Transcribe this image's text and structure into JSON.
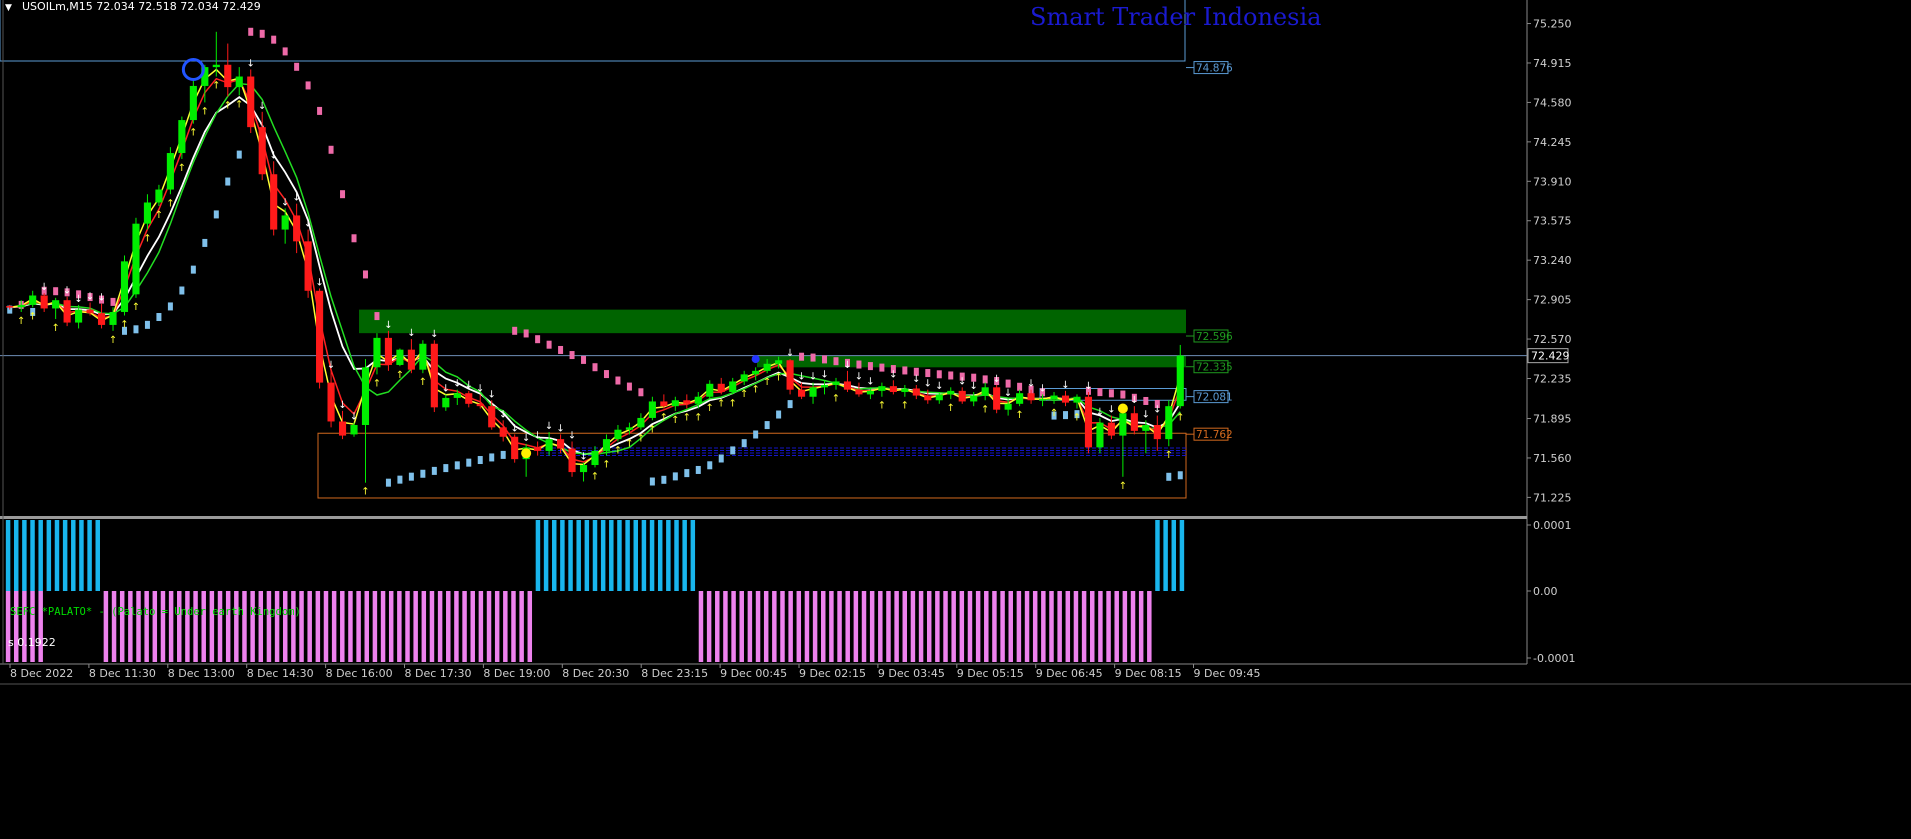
{
  "header": {
    "symbol_label": "USOILm,M15",
    "ohlc_label": "72.034 72.518 72.034 72.429",
    "watermark": "Smart Trader Indonesia",
    "indicator_caption": "SEFC *PALATO* - (Palato = Under earth Kingdom)"
  },
  "subwindow": {
    "label": "s 0.1922"
  },
  "colors": {
    "background": "#000000",
    "bull_candle": "#00ee00",
    "bear_candle": "#ff1a1a",
    "ma_yellow": "#ffff33",
    "ma_red": "#ff2222",
    "ma_white": "#ffffff",
    "ma_green": "#22dd22",
    "psar_blue": "#7fc0ea",
    "psar_pink": "#ee6aa8",
    "zone_green": "#006400",
    "hist_cyan": "#19b6ee",
    "hist_violet": "#ee82ee",
    "grid_text": "#cfcfcf",
    "watermark": "#1a1ad0"
  },
  "chart_data": [
    {
      "type": "candlestick",
      "symbol": "USOILm",
      "timeframe": "M15",
      "ylim": [
        71.05,
        75.45
      ],
      "y_ticks": [
        "75.250",
        "74.915",
        "74.580",
        "74.245",
        "73.910",
        "73.575",
        "73.240",
        "72.905",
        "72.570",
        "72.235",
        "71.895",
        "71.560",
        "71.225"
      ],
      "x_tick_labels": [
        "8 Dec 2022",
        "8 Dec 11:30",
        "8 Dec 13:00",
        "8 Dec 14:30",
        "8 Dec 16:00",
        "8 Dec 17:30",
        "8 Dec 19:00",
        "8 Dec 20:30",
        "8 Dec 23:15",
        "9 Dec 00:45",
        "9 Dec 02:15",
        "9 Dec 03:45",
        "9 Dec 05:15",
        "9 Dec 06:45",
        "9 Dec 08:15",
        "9 Dec 09:45"
      ],
      "price_levels": [
        {
          "label": "74.876",
          "value": 74.876,
          "color": "#5b9bd5"
        },
        {
          "label": "72.596",
          "value": 72.596,
          "color": "#1f9a1f"
        },
        {
          "label": "72.335",
          "value": 72.335,
          "color": "#1f9a1f"
        },
        {
          "label": "72.081",
          "value": 72.081,
          "color": "#5b9bd5"
        },
        {
          "label": "71.762",
          "value": 71.762,
          "color": "#d2691e"
        }
      ],
      "current_price": {
        "label": "72.429",
        "value": 72.429
      },
      "zones": [
        {
          "kind": "supply",
          "from": 72.62,
          "to": 72.82
        },
        {
          "kind": "supply",
          "from": 72.33,
          "to": 72.43
        },
        {
          "kind": "box",
          "from": 71.22,
          "to": 71.77
        }
      ],
      "candles": [
        [
          72.85,
          72.86,
          72.82,
          72.84
        ],
        [
          72.84,
          72.9,
          72.8,
          72.86
        ],
        [
          72.86,
          72.98,
          72.84,
          72.94
        ],
        [
          72.94,
          72.96,
          72.8,
          72.83
        ],
        [
          72.83,
          72.92,
          72.74,
          72.9
        ],
        [
          72.9,
          72.93,
          72.68,
          72.71
        ],
        [
          72.71,
          72.86,
          72.66,
          72.82
        ],
        [
          72.82,
          72.88,
          72.77,
          72.79
        ],
        [
          72.79,
          72.87,
          72.66,
          72.69
        ],
        [
          72.69,
          72.84,
          72.64,
          72.8
        ],
        [
          72.8,
          73.28,
          72.77,
          73.23
        ],
        [
          72.95,
          73.6,
          72.92,
          73.55
        ],
        [
          73.55,
          73.8,
          73.5,
          73.73
        ],
        [
          73.73,
          73.88,
          73.7,
          73.84
        ],
        [
          73.84,
          74.2,
          73.8,
          74.15
        ],
        [
          74.15,
          74.46,
          74.1,
          74.43
        ],
        [
          74.43,
          74.78,
          74.4,
          74.72
        ],
        [
          74.72,
          74.9,
          74.58,
          74.88
        ],
        [
          74.88,
          75.18,
          74.8,
          74.9
        ],
        [
          74.9,
          75.08,
          74.63,
          74.71
        ],
        [
          74.71,
          74.88,
          74.64,
          74.8
        ],
        [
          74.8,
          74.86,
          74.32,
          74.37
        ],
        [
          74.37,
          74.5,
          73.92,
          73.97
        ],
        [
          73.97,
          74.08,
          73.45,
          73.5
        ],
        [
          73.5,
          73.68,
          73.38,
          73.62
        ],
        [
          73.62,
          73.72,
          73.3,
          73.4
        ],
        [
          73.4,
          73.5,
          72.92,
          72.98
        ],
        [
          72.98,
          73.0,
          72.15,
          72.2
        ],
        [
          72.2,
          72.3,
          71.82,
          71.87
        ],
        [
          71.87,
          71.96,
          71.72,
          71.75
        ],
        [
          71.76,
          71.86,
          71.74,
          71.84
        ],
        [
          71.84,
          72.4,
          71.35,
          72.33
        ],
        [
          72.33,
          72.62,
          72.27,
          72.58
        ],
        [
          72.58,
          72.64,
          72.3,
          72.35
        ],
        [
          72.35,
          72.49,
          72.34,
          72.48
        ],
        [
          72.48,
          72.57,
          72.28,
          72.31
        ],
        [
          72.31,
          72.56,
          72.28,
          72.53
        ],
        [
          72.53,
          72.56,
          71.95,
          71.99
        ],
        [
          71.99,
          72.1,
          71.96,
          72.07
        ],
        [
          72.07,
          72.14,
          72.01,
          72.11
        ],
        [
          72.11,
          72.13,
          71.99,
          72.02
        ],
        [
          72.02,
          72.1,
          71.98,
          72.0
        ],
        [
          72.0,
          72.05,
          71.8,
          71.82
        ],
        [
          71.82,
          71.88,
          71.7,
          71.74
        ],
        [
          71.74,
          71.76,
          71.52,
          71.55
        ],
        [
          71.55,
          71.68,
          71.4,
          71.65
        ],
        [
          71.65,
          71.7,
          71.58,
          71.62
        ],
        [
          71.62,
          71.78,
          71.58,
          71.72
        ],
        [
          71.72,
          71.76,
          71.6,
          71.64
        ],
        [
          71.64,
          71.7,
          71.4,
          71.44
        ],
        [
          71.44,
          71.52,
          71.36,
          71.5
        ],
        [
          71.5,
          71.66,
          71.48,
          71.62
        ],
        [
          71.62,
          71.76,
          71.58,
          71.72
        ],
        [
          71.72,
          71.84,
          71.7,
          71.8
        ],
        [
          71.8,
          71.86,
          71.76,
          71.82
        ],
        [
          71.82,
          71.94,
          71.8,
          71.9
        ],
        [
          71.9,
          72.08,
          71.88,
          72.04
        ],
        [
          72.04,
          72.1,
          71.98,
          72.0
        ],
        [
          72.0,
          72.08,
          71.96,
          72.05
        ],
        [
          72.05,
          72.1,
          71.98,
          72.02
        ],
        [
          72.02,
          72.12,
          71.98,
          72.08
        ],
        [
          72.08,
          72.22,
          72.06,
          72.19
        ],
        [
          72.19,
          72.24,
          72.1,
          72.12
        ],
        [
          72.12,
          72.24,
          72.1,
          72.21
        ],
        [
          72.21,
          72.3,
          72.18,
          72.27
        ],
        [
          72.27,
          72.33,
          72.22,
          72.3
        ],
        [
          72.3,
          72.4,
          72.28,
          72.36
        ],
        [
          72.36,
          72.42,
          72.32,
          72.39
        ],
        [
          72.39,
          72.4,
          72.1,
          72.14
        ],
        [
          72.14,
          72.2,
          72.06,
          72.08
        ],
        [
          72.08,
          72.2,
          72.02,
          72.16
        ],
        [
          72.16,
          72.22,
          72.1,
          72.18
        ],
        [
          72.18,
          72.24,
          72.14,
          72.21
        ],
        [
          72.21,
          72.3,
          72.12,
          72.14
        ],
        [
          72.14,
          72.2,
          72.08,
          72.1
        ],
        [
          72.1,
          72.16,
          72.06,
          72.13
        ],
        [
          72.13,
          72.2,
          72.08,
          72.17
        ],
        [
          72.17,
          72.22,
          72.1,
          72.12
        ],
        [
          72.12,
          72.18,
          72.08,
          72.15
        ],
        [
          72.15,
          72.18,
          72.06,
          72.09
        ],
        [
          72.09,
          72.14,
          72.02,
          72.05
        ],
        [
          72.05,
          72.12,
          72.02,
          72.1
        ],
        [
          72.1,
          72.16,
          72.06,
          72.13
        ],
        [
          72.13,
          72.16,
          72.02,
          72.04
        ],
        [
          72.04,
          72.12,
          72.0,
          72.09
        ],
        [
          72.09,
          72.2,
          72.05,
          72.16
        ],
        [
          72.16,
          72.18,
          71.94,
          71.97
        ],
        [
          71.97,
          72.06,
          71.92,
          72.02
        ],
        [
          72.02,
          72.14,
          72.0,
          72.11
        ],
        [
          72.11,
          72.14,
          72.02,
          72.05
        ],
        [
          72.05,
          72.1,
          72.0,
          72.06
        ],
        [
          72.06,
          72.12,
          72.02,
          72.09
        ],
        [
          72.09,
          72.13,
          72.0,
          72.03
        ],
        [
          72.03,
          72.1,
          71.98,
          72.08
        ],
        [
          72.08,
          72.12,
          71.6,
          71.65
        ],
        [
          71.65,
          71.9,
          71.6,
          71.86
        ],
        [
          71.86,
          71.92,
          71.72,
          71.75
        ],
        [
          71.75,
          71.98,
          71.4,
          71.94
        ],
        [
          71.94,
          72.0,
          71.76,
          71.79
        ],
        [
          71.79,
          71.88,
          71.6,
          71.84
        ],
        [
          71.84,
          71.92,
          71.62,
          71.72
        ],
        [
          71.72,
          72.05,
          71.66,
          72.0
        ],
        [
          72.0,
          72.52,
          71.98,
          72.43
        ]
      ]
    },
    {
      "type": "bar",
      "name": "sub-window histogram",
      "ylim": [
        -0.0001,
        0.0001
      ],
      "y_ticks": [
        "0.0001",
        "0.00",
        "-0.0001"
      ],
      "bar_runs": [
        {
          "from": 0,
          "to": 11,
          "value": 0.0001,
          "color": "hist_cyan"
        },
        {
          "from": 0,
          "to": 4,
          "value": -0.0001,
          "color": "hist_violet"
        },
        {
          "from": 12,
          "to": 64,
          "value": -0.0001,
          "color": "hist_violet"
        },
        {
          "from": 65,
          "to": 84,
          "value": 0.0001,
          "color": "hist_cyan"
        },
        {
          "from": 85,
          "to": 140,
          "value": -0.0001,
          "color": "hist_violet"
        },
        {
          "from": 141,
          "to": 144,
          "value": 0.0001,
          "color": "hist_cyan"
        }
      ]
    }
  ]
}
